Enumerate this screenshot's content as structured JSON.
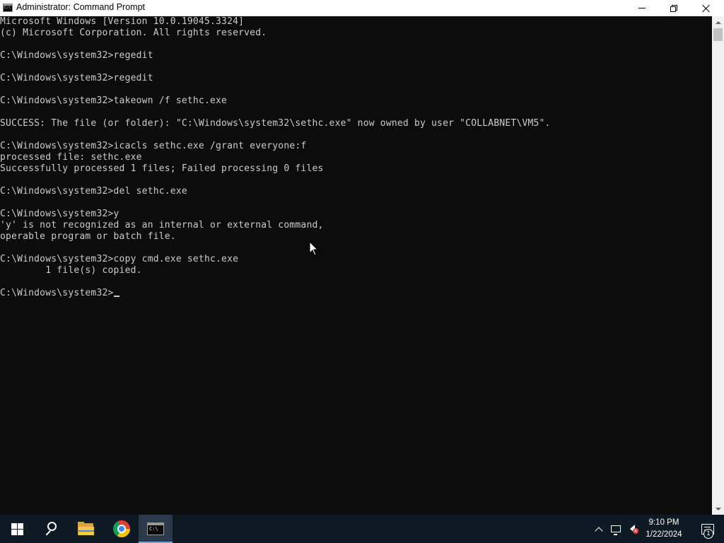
{
  "window": {
    "title": "Administrator: Command Prompt",
    "icon": "command-prompt-icon",
    "controls": {
      "minimize_icon": "minimize-icon",
      "restore_icon": "restore-icon",
      "close_icon": "close-icon"
    }
  },
  "console": {
    "lines": [
      "Microsoft Windows [Version 10.0.19045.3324]",
      "(c) Microsoft Corporation. All rights reserved.",
      "",
      "C:\\Windows\\system32>regedit",
      "",
      "C:\\Windows\\system32>regedit",
      "",
      "C:\\Windows\\system32>takeown /f sethc.exe",
      "",
      "SUCCESS: The file (or folder): \"C:\\Windows\\system32\\sethc.exe\" now owned by user \"COLLABNET\\VM5\".",
      "",
      "C:\\Windows\\system32>icacls sethc.exe /grant everyone:f",
      "processed file: sethc.exe",
      "Successfully processed 1 files; Failed processing 0 files",
      "",
      "C:\\Windows\\system32>del sethc.exe",
      "",
      "C:\\Windows\\system32>y",
      "'y' is not recognized as an internal or external command,",
      "operable program or batch file.",
      "",
      "C:\\Windows\\system32>copy cmd.exe sethc.exe",
      "        1 file(s) copied.",
      ""
    ],
    "prompt": "C:\\Windows\\system32>"
  },
  "colors": {
    "console_bg": "#0c0c0c",
    "console_text": "#cccccc",
    "taskbar_bg": "#0f1a24",
    "accent": "#6aa7e0"
  },
  "taskbar": {
    "items": [
      {
        "name": "start",
        "icon": "windows-logo-icon"
      },
      {
        "name": "search",
        "icon": "search-icon"
      },
      {
        "name": "file-explorer",
        "icon": "folder-icon"
      },
      {
        "name": "chrome",
        "icon": "chrome-icon"
      },
      {
        "name": "command-prompt",
        "icon": "command-prompt-icon",
        "active": true
      }
    ],
    "tray": {
      "icons": [
        "chevron-up-icon",
        "network-icon",
        "volume-muted-icon"
      ],
      "time": "9:10 PM",
      "date": "1/22/2024",
      "notification_count": "1"
    }
  }
}
